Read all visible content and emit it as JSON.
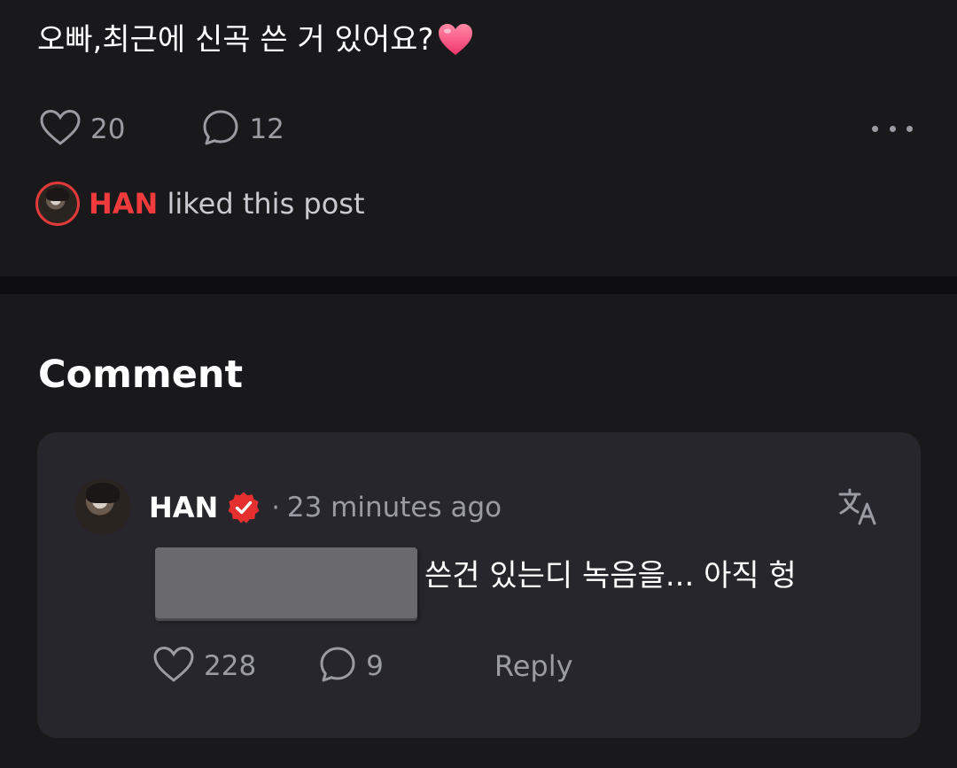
{
  "post": {
    "text": "오빠,최근에 신곡 쓴 거 있어요?",
    "like_count": "20",
    "comment_count": "12",
    "liked_by": {
      "name": "HAN",
      "suffix": "liked this post"
    }
  },
  "comments": {
    "heading": "Comment",
    "items": [
      {
        "author": "HAN",
        "separator": "·",
        "timestamp": "23 minutes ago",
        "text": "쓴건 있는디 녹음을... 아직 헝",
        "like_count": "228",
        "reply_count": "9",
        "reply_label": "Reply"
      }
    ]
  },
  "colors": {
    "background": "#19191c",
    "card": "#26262c",
    "accent_red": "#ef3b3b",
    "muted": "#9b9ba3"
  },
  "icons": [
    "heart-emoji",
    "heart-outline-icon",
    "comment-bubble-icon",
    "more-dots-icon",
    "verified-badge-icon",
    "translate-icon"
  ]
}
